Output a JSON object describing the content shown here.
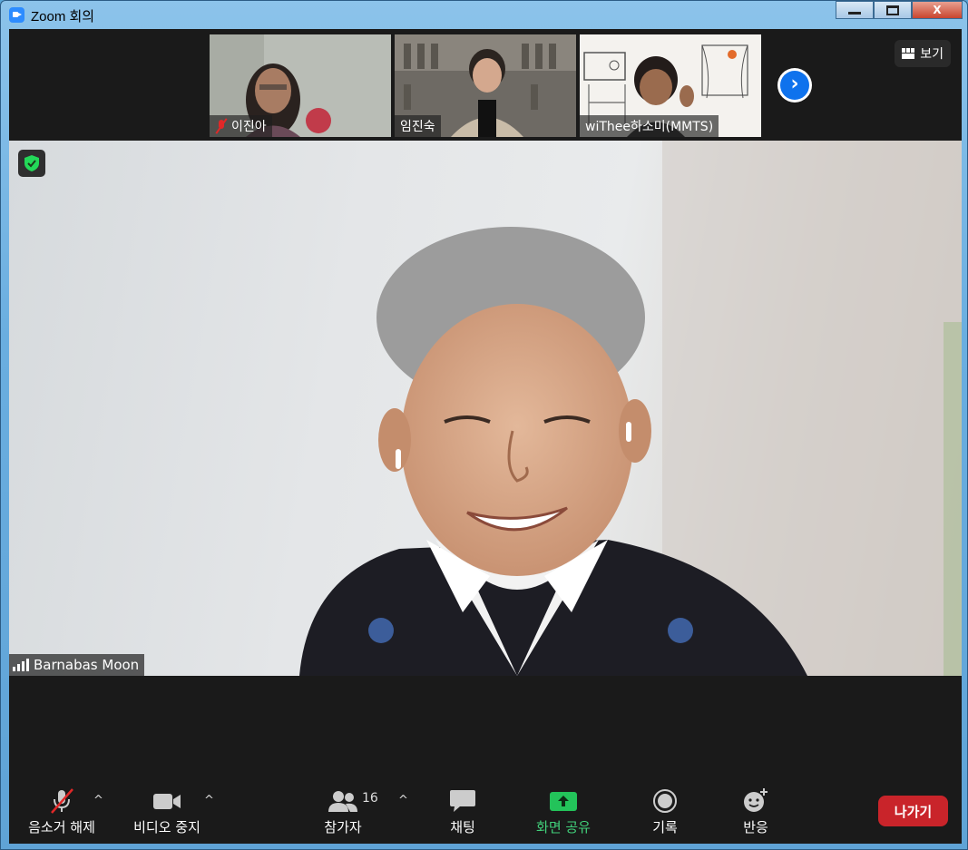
{
  "window": {
    "title": "Zoom 회의",
    "controls": {
      "minimize": "",
      "maximize": "",
      "close": "X"
    }
  },
  "strip": {
    "thumbnails": [
      {
        "name": "이진아",
        "muted": true
      },
      {
        "name": "임진숙",
        "muted": false
      },
      {
        "name": "wiThee하소미(MMTS)",
        "muted": false
      }
    ],
    "view_label": "보기"
  },
  "speaker": {
    "name": "Barnabas Moon"
  },
  "toolbar": {
    "mute_label": "음소거 해제",
    "video_label": "비디오 중지",
    "participants_label": "참가자",
    "participants_count": "16",
    "chat_label": "채팅",
    "share_label": "화면 공유",
    "record_label": "기록",
    "reactions_label": "반응",
    "leave_label": "나가기",
    "caret": "^"
  },
  "colors": {
    "accent_blue": "#0e72ed",
    "share_green": "#41d07a",
    "leave_red": "#c9242a",
    "muted_red": "#e02828"
  }
}
